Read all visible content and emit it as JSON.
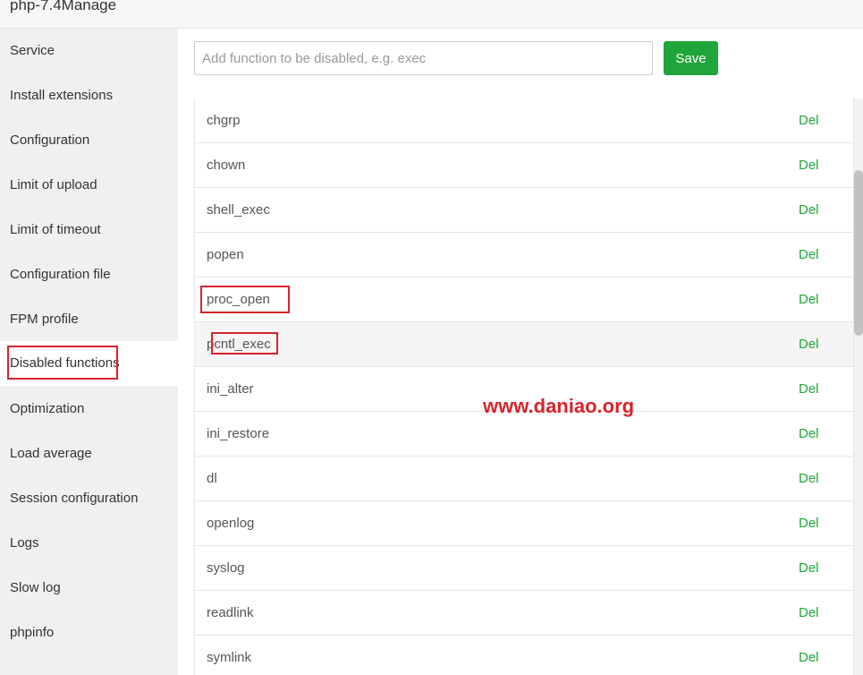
{
  "window": {
    "title": "php-7.4Manage"
  },
  "sidebar": {
    "items": [
      {
        "label": "Service"
      },
      {
        "label": "Install extensions"
      },
      {
        "label": "Configuration"
      },
      {
        "label": "Limit of upload"
      },
      {
        "label": "Limit of timeout"
      },
      {
        "label": "Configuration file"
      },
      {
        "label": "FPM profile"
      },
      {
        "label": "Disabled functions",
        "active": true
      },
      {
        "label": "Optimization"
      },
      {
        "label": "Load average"
      },
      {
        "label": "Session configuration"
      },
      {
        "label": "Logs"
      },
      {
        "label": "Slow log"
      },
      {
        "label": "phpinfo"
      }
    ]
  },
  "form": {
    "input_placeholder": "Add function to be disabled, e.g. exec",
    "input_value": "",
    "save_label": "Save"
  },
  "table": {
    "action_label": "Del",
    "rows": [
      {
        "name": "chgrp"
      },
      {
        "name": "chown"
      },
      {
        "name": "shell_exec"
      },
      {
        "name": "popen"
      },
      {
        "name": "proc_open"
      },
      {
        "name": "pcntl_exec"
      },
      {
        "name": "ini_alter"
      },
      {
        "name": "ini_restore"
      },
      {
        "name": "dl"
      },
      {
        "name": "openlog"
      },
      {
        "name": "syslog"
      },
      {
        "name": "readlink"
      },
      {
        "name": "symlink"
      }
    ]
  },
  "watermark": "www.daniao.org",
  "colors": {
    "accent": "#20a53a",
    "highlight": "#d9232d",
    "sidebar_bg": "#f0f0f0"
  }
}
